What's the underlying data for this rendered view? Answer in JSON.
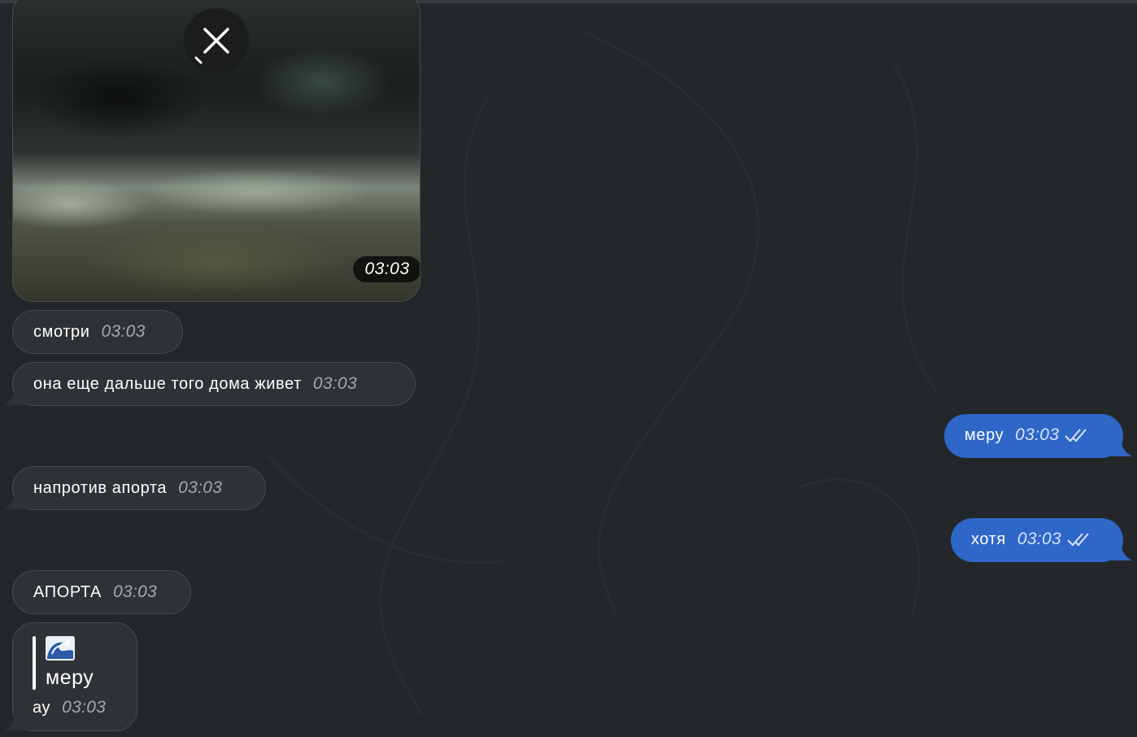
{
  "media_message": {
    "time": "03:03"
  },
  "incoming": [
    {
      "text": "смотри",
      "time": "03:03"
    },
    {
      "text": "она еще дальше того дома живет",
      "time": "03:03"
    },
    {
      "text": "напротив апорта",
      "time": "03:03"
    },
    {
      "text": "АПОРТА",
      "time": "03:03"
    }
  ],
  "outgoing": [
    {
      "text": "меру",
      "time": "03:03",
      "status": "read"
    },
    {
      "text": "хотя",
      "time": "03:03",
      "status": "read"
    }
  ],
  "reply_message": {
    "quoted_emoji": "wave-emoji",
    "quoted_text": "меру",
    "text": "ау",
    "time": "03:03"
  },
  "colors": {
    "background": "#24272a",
    "incoming_bubble": "#2f3235",
    "outgoing_bubble": "#2e67c8"
  }
}
